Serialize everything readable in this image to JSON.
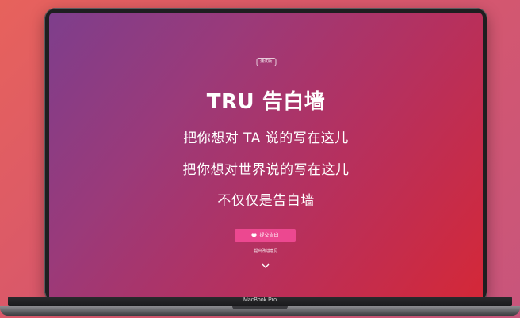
{
  "badge": "测试版",
  "title": "TRU 告白墙",
  "lines": [
    "把你想对 TA 说的写在这儿",
    "把你想对世界说的写在这儿",
    "不仅仅是告白墙"
  ],
  "submit_button": {
    "label": "提交告白",
    "icon": "heart-icon",
    "color": "#ec4890"
  },
  "feedback_link": "提出改进意见",
  "scroll_icon": "chevron-down-icon",
  "device_label": "MacBook Pro"
}
